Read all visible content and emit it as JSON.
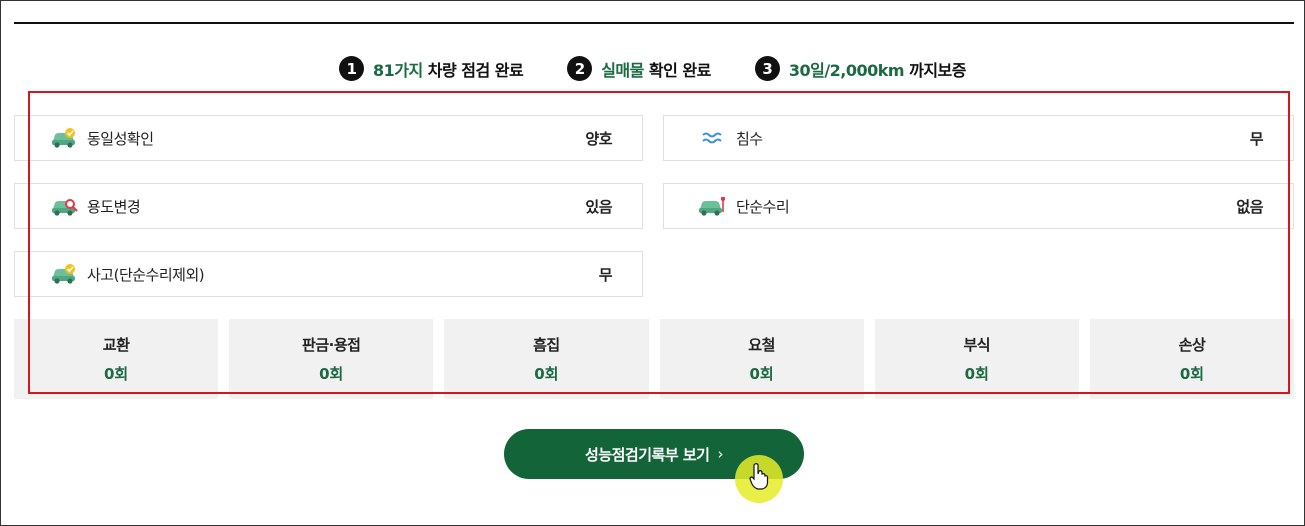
{
  "steps": [
    {
      "num": "1",
      "highlight": "81가지",
      "rest": "차량 점검 완료"
    },
    {
      "num": "2",
      "highlight": "실매물",
      "rest": "확인 완료"
    },
    {
      "num": "3",
      "highlight": "30일/2,000km",
      "rest": "까지보증"
    }
  ],
  "items": [
    {
      "icon": "car-check-icon",
      "label": "동일성확인",
      "value": "양호"
    },
    {
      "icon": "water-wave-icon",
      "label": "침수",
      "value": "무"
    },
    {
      "icon": "car-search-icon",
      "label": "용도변경",
      "value": "있음"
    },
    {
      "icon": "car-repair-icon",
      "label": "단순수리",
      "value": "없음"
    },
    {
      "icon": "car-check-icon",
      "label": "사고(단순수리제외)",
      "value": "무"
    }
  ],
  "counts": [
    {
      "label": "교환",
      "value": "0회"
    },
    {
      "label": "판금·용접",
      "value": "0회"
    },
    {
      "label": "흠집",
      "value": "0회"
    },
    {
      "label": "요철",
      "value": "0회"
    },
    {
      "label": "부식",
      "value": "0회"
    },
    {
      "label": "손상",
      "value": "0회"
    }
  ],
  "cta": {
    "label": "성능점검기록부 보기",
    "chevron": "›"
  },
  "colors": {
    "accent": "#1b6a43",
    "button": "#136438",
    "highlight_box": "#d8141c"
  }
}
